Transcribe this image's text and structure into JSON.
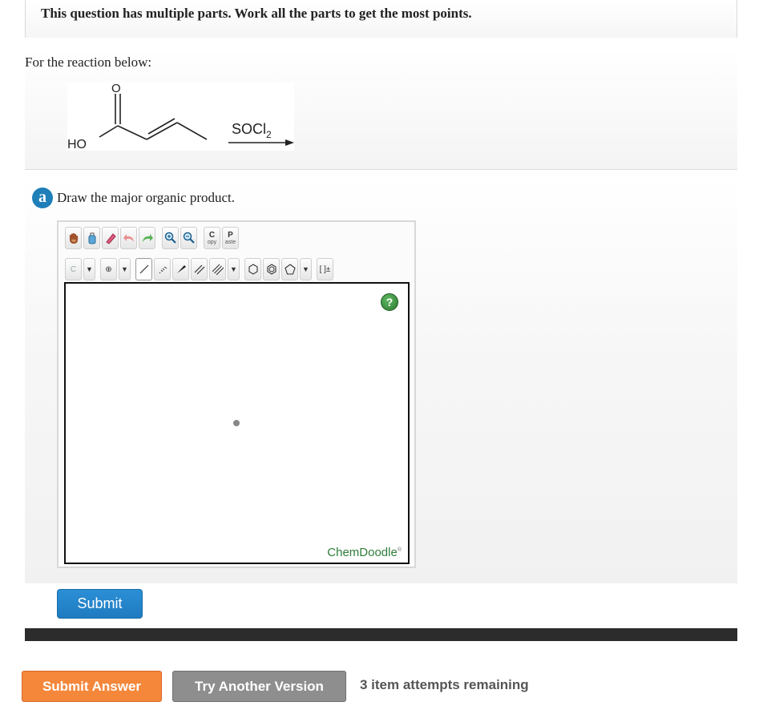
{
  "banner": {
    "text": "This question has multiple parts. Work all the parts to get the most points."
  },
  "question": {
    "prompt": "For the reaction below:",
    "reaction": {
      "reagent_main": "SOCl",
      "reagent_sub": "2",
      "oxygen": "O",
      "hydroxyl": "HO"
    }
  },
  "part_a": {
    "badge": "a",
    "instruction": "Draw the major organic product.",
    "submit_label": "Submit"
  },
  "editor": {
    "element_value": "C",
    "copy_label": {
      "big": "C",
      "small": "opy"
    },
    "paste_label": {
      "big": "P",
      "small": "aste"
    },
    "charge_label": "[ ]±",
    "help_label": "?",
    "brand": "ChemDoodle",
    "brand_mark": "®"
  },
  "footer": {
    "submit_answer": "Submit Answer",
    "try_another": "Try Another Version",
    "attempts": "3 item attempts remaining"
  },
  "colors": {
    "badge": "#1f7fb8",
    "submit_blue": "#2b8fd6",
    "submit_orange": "#f4873a",
    "try_gray": "#8e8e8e",
    "brand_green": "#2e7d39"
  }
}
